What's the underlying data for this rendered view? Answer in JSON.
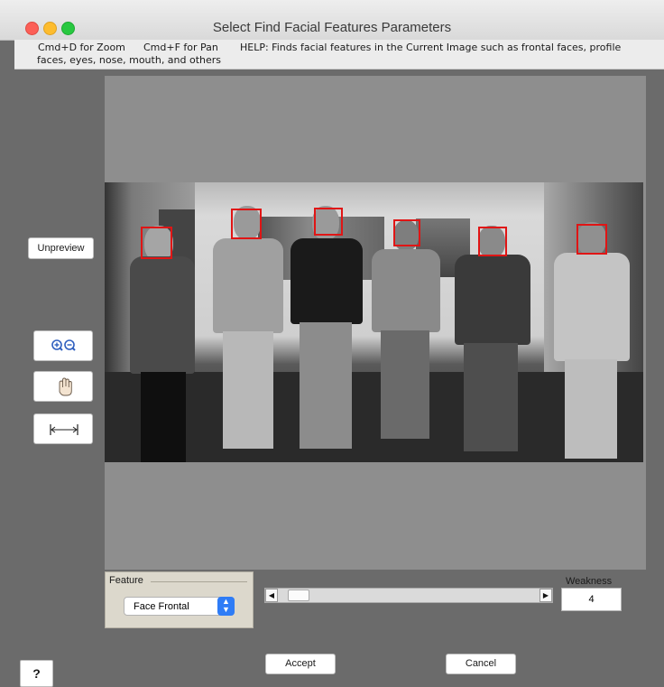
{
  "window": {
    "title": "Select Find Facial Features Parameters"
  },
  "help": {
    "zoom_hint": "Cmd+D for Zoom",
    "pan_hint": "Cmd+F for Pan",
    "help_line1": "HELP:  Finds facial features in the Current Image such as frontal faces, profile",
    "help_line2": "faces, eyes, nose, mouth, and others"
  },
  "tools": {
    "unpreview_label": "Unpreview",
    "zoom_icon": "zoom-in-out-icon",
    "pan_icon": "hand-pan-icon",
    "fit_icon": "fit-width-icon"
  },
  "feature": {
    "legend": "Feature",
    "selected": "Face Frontal"
  },
  "weakness": {
    "label": "Weakness",
    "value": "4",
    "slider_fraction": 0.04
  },
  "buttons": {
    "accept": "Accept",
    "cancel": "Cancel",
    "help": "?"
  },
  "preview": {
    "detected_faces": 6,
    "box_color": "#e01515"
  }
}
